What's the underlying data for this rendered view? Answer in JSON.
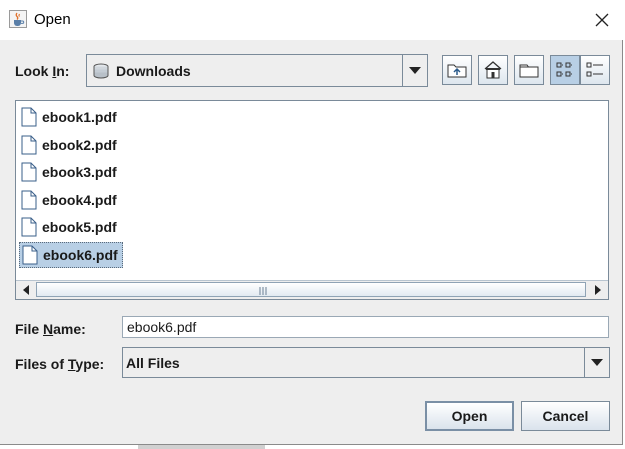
{
  "window": {
    "title": "Open",
    "title_icon": "java-cup-icon",
    "close_icon": "close-icon"
  },
  "look_in": {
    "label_pre": "Look ",
    "label_mnemonic": "I",
    "label_post": "n:",
    "value": "Downloads",
    "value_icon": "drive-icon"
  },
  "toolbar": {
    "buttons": [
      {
        "name": "up-one-level",
        "icon": "folder-up-icon"
      },
      {
        "name": "home",
        "icon": "home-icon"
      },
      {
        "name": "create-new-folder",
        "icon": "new-folder-icon"
      },
      {
        "name": "list-view",
        "icon": "list-view-icon",
        "pressed": true
      },
      {
        "name": "details-view",
        "icon": "details-view-icon",
        "pressed": false
      }
    ]
  },
  "files": [
    {
      "name": "ebook1.pdf",
      "selected": false
    },
    {
      "name": "ebook2.pdf",
      "selected": false
    },
    {
      "name": "ebook3.pdf",
      "selected": false
    },
    {
      "name": "ebook4.pdf",
      "selected": false
    },
    {
      "name": "ebook5.pdf",
      "selected": false
    },
    {
      "name": "ebook6.pdf",
      "selected": true
    }
  ],
  "file_name": {
    "label_pre": "File ",
    "label_mnemonic": "N",
    "label_post": "ame:",
    "value": "ebook6.pdf"
  },
  "files_of_type": {
    "label_pre": "Files of ",
    "label_mnemonic": "T",
    "label_post": "ype:",
    "value": "All Files"
  },
  "buttons": {
    "open": "Open",
    "cancel": "Cancel"
  },
  "colors": {
    "selection": "#b8cfe5",
    "border": "#7a8a99",
    "background": "#eeeeee"
  }
}
